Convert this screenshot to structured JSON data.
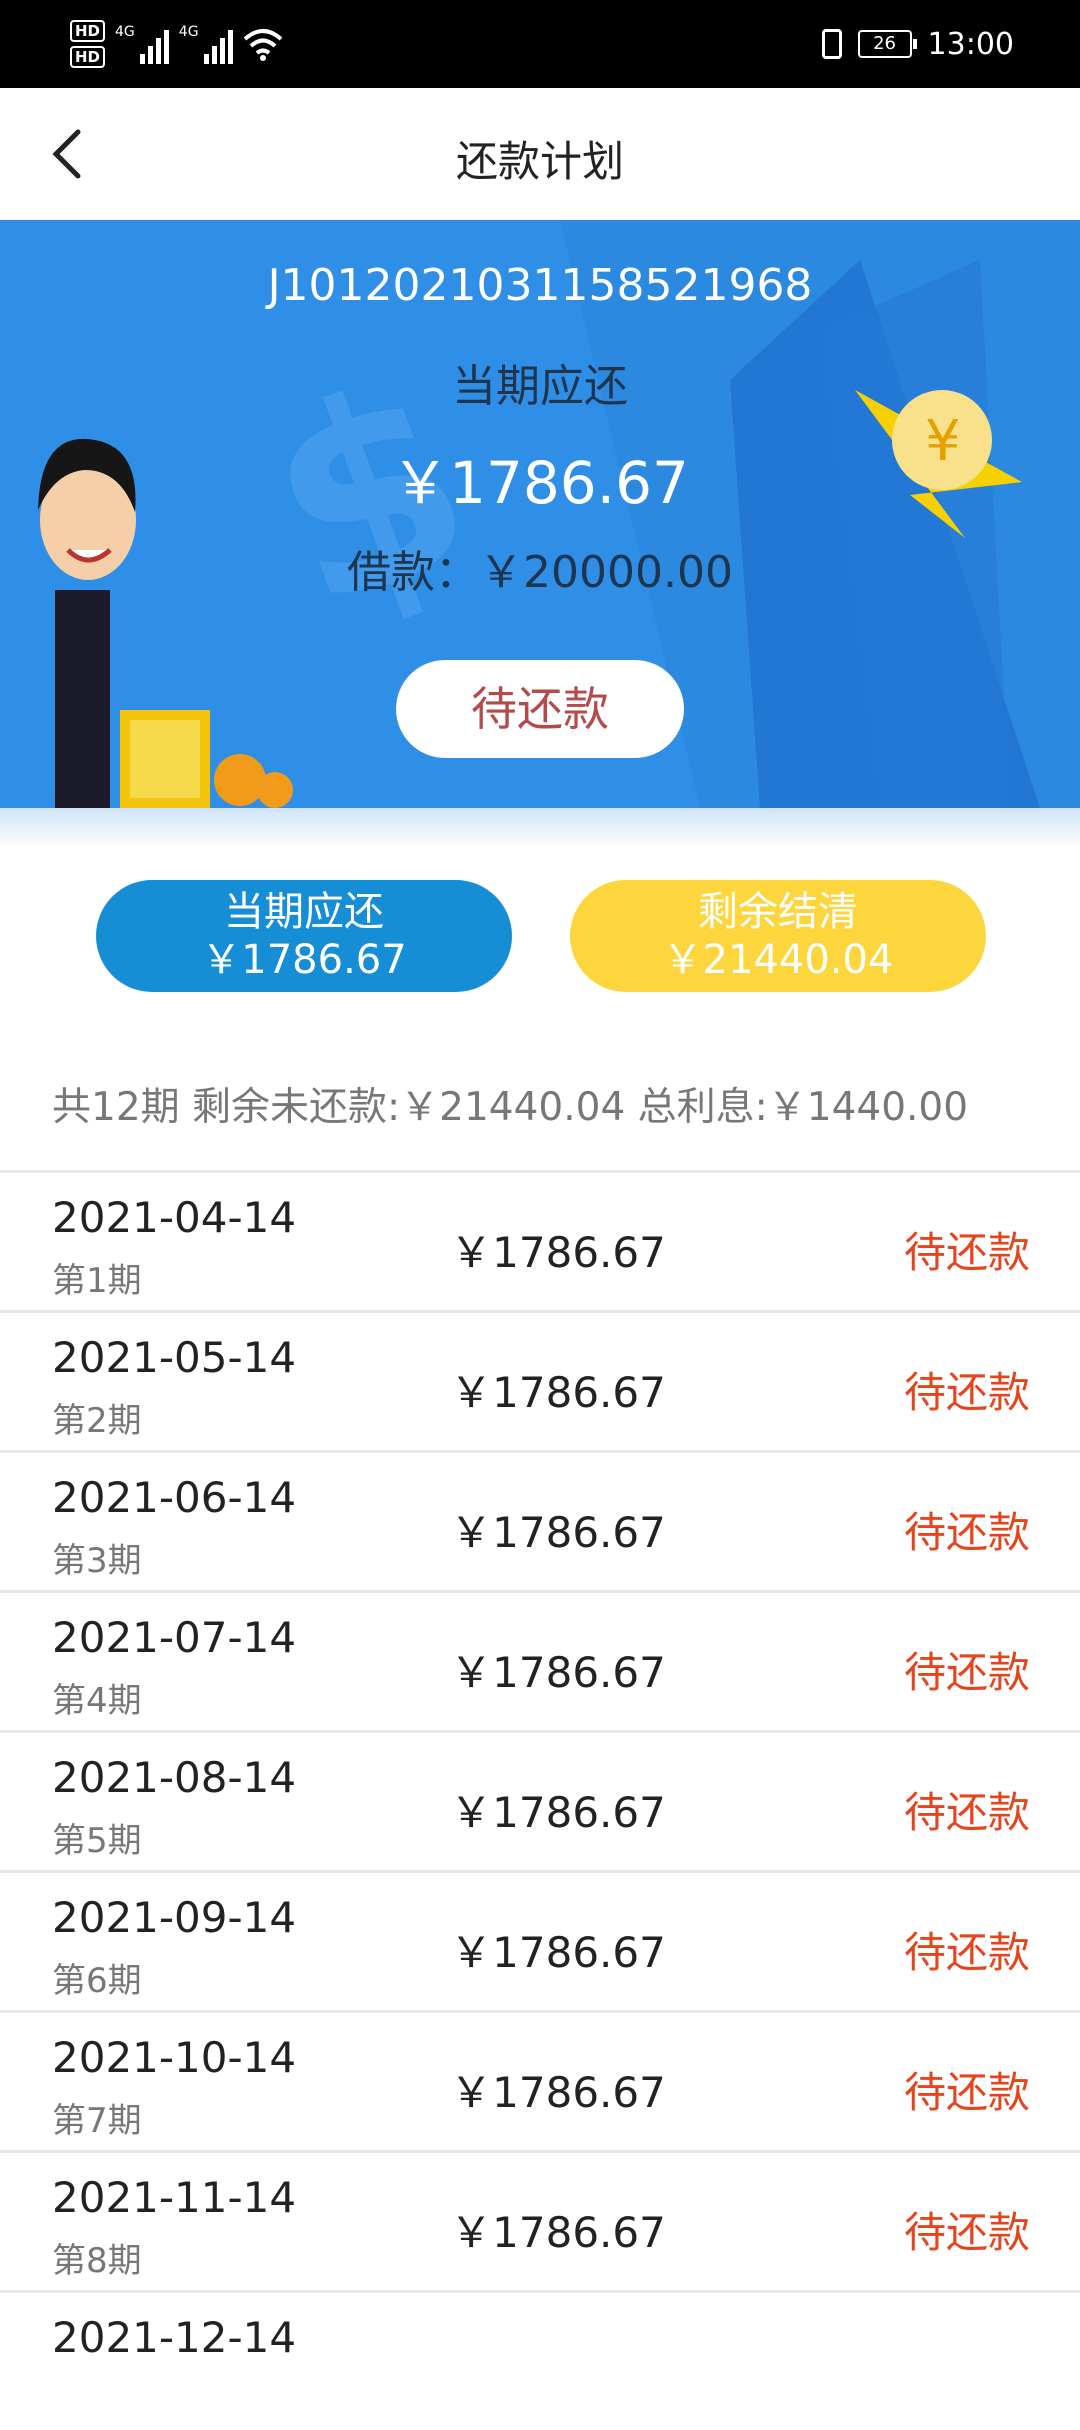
{
  "status_bar": {
    "hd1": "HD",
    "hd2": "HD",
    "net1": "4G",
    "net2": "4G",
    "battery": "26",
    "time": "13:00"
  },
  "header": {
    "title": "还款计划"
  },
  "banner": {
    "loan_no": "J1012021031158521968",
    "current_label": "当期应还",
    "current_amount": "￥1786.67",
    "borrow_label": "借款：￥20000.00",
    "status": "待还款",
    "bg_color": "#2f8fe6"
  },
  "summary_buttons": {
    "current_label": "当期应还",
    "current_amount": "￥1786.67",
    "payoff_label": "剩余结清",
    "payoff_amount": "￥21440.04"
  },
  "summary_line": "共12期  剩余未还款:￥21440.04  总利息:￥1440.00",
  "installments": [
    {
      "date": "2021-04-14",
      "period": "第1期",
      "amount": "￥1786.67",
      "status": "待还款"
    },
    {
      "date": "2021-05-14",
      "period": "第2期",
      "amount": "￥1786.67",
      "status": "待还款"
    },
    {
      "date": "2021-06-14",
      "period": "第3期",
      "amount": "￥1786.67",
      "status": "待还款"
    },
    {
      "date": "2021-07-14",
      "period": "第4期",
      "amount": "￥1786.67",
      "status": "待还款"
    },
    {
      "date": "2021-08-14",
      "period": "第5期",
      "amount": "￥1786.67",
      "status": "待还款"
    },
    {
      "date": "2021-09-14",
      "period": "第6期",
      "amount": "￥1786.67",
      "status": "待还款"
    },
    {
      "date": "2021-10-14",
      "period": "第7期",
      "amount": "￥1786.67",
      "status": "待还款"
    },
    {
      "date": "2021-11-14",
      "period": "第8期",
      "amount": "￥1786.67",
      "status": "待还款"
    },
    {
      "date": "2021-12-14",
      "period": "",
      "amount": "",
      "status": ""
    }
  ],
  "colors": {
    "pending": "#e5451e",
    "blue_button": "#158ed6",
    "yellow_button": "#fdd53c"
  }
}
